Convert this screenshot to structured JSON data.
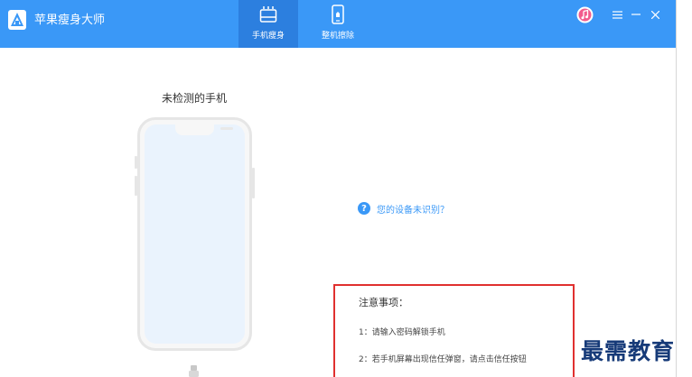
{
  "app": {
    "title": "苹果瘦身大师"
  },
  "tabs": [
    {
      "label": "手机瘦身",
      "icon": "broom-icon",
      "active": true
    },
    {
      "label": "整机擦除",
      "icon": "phone-erase-icon",
      "active": false
    }
  ],
  "window_controls": [
    "itunes-icon",
    "menu-icon",
    "minimize-icon",
    "close-icon"
  ],
  "device": {
    "status_label": "未检测的手机"
  },
  "help": {
    "icon": "question-icon",
    "text": "您的设备未识别？"
  },
  "notice": {
    "title": "注意事项：",
    "items": [
      "1：请输入密码解锁手机",
      "2：若手机屏幕出现信任弹窗，请点击信任按钮"
    ]
  },
  "watermark": {
    "text": "最需教育"
  },
  "colors": {
    "titlebar": "#3a98f7",
    "active_tab": "#2c7fdf",
    "accent": "#3a98f7",
    "highlight_box": "#e0302f"
  }
}
